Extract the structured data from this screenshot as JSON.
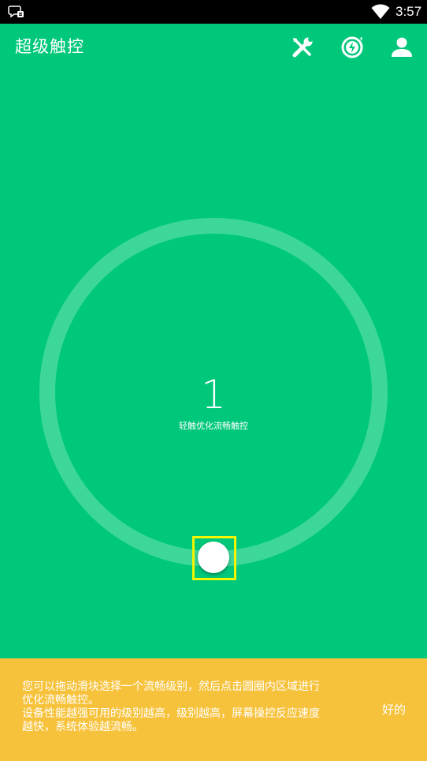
{
  "status_bar": {
    "time": "3:57",
    "left_icon": "chat-notification-icon",
    "wifi_icon": "wifi-icon"
  },
  "app_bar": {
    "title": "超级触控",
    "actions": [
      {
        "icon": "tools-icon"
      },
      {
        "icon": "boost-icon"
      },
      {
        "icon": "user-icon"
      }
    ]
  },
  "control": {
    "level": "1",
    "level_description": "轻触优化流畅触控"
  },
  "tip": {
    "lines": [
      "您可以拖动滑块选择一个流畅级别，然后点击圆圈内区域进行",
      "优化流畅触控。",
      "设备性能越强可用的级别越高，级别越高，屏幕操控反应速度",
      "越快，系统体验越流畅。"
    ],
    "ok_label": "好的"
  },
  "colors": {
    "background": "#00C87B",
    "ring": "#3DD79A",
    "tip_background": "#F7C23B",
    "highlight": "#F5F500"
  }
}
